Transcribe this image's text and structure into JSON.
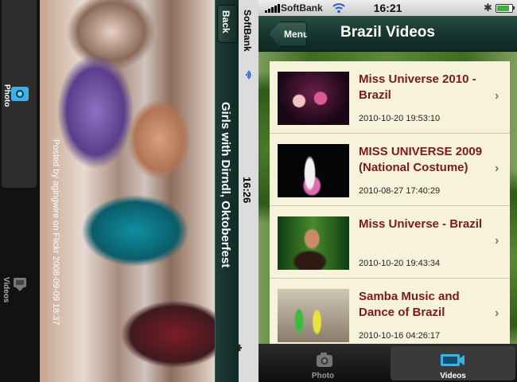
{
  "photo_screen": {
    "title": "Girls with Dirndl, Oktoberfest",
    "back_label": "Back",
    "caption": "Posted by agingwire on Flickr 2008-09-09 18:37",
    "status": {
      "carrier": "SoftBank",
      "time": "16:26"
    },
    "tabs": [
      {
        "label": "Photo",
        "icon": "camera-icon",
        "selected": true
      },
      {
        "label": "Videos",
        "icon": "video-camera-icon",
        "selected": false
      }
    ]
  },
  "video_screen": {
    "status": {
      "carrier": "SoftBank",
      "time": "16:21",
      "battery_level": 0.85
    },
    "navbar": {
      "title": "Brazil Videos",
      "menu_label": "Menu"
    },
    "videos": [
      {
        "title": "Miss Universe 2010 - Brazil",
        "date": "2010-10-20 19:53:10"
      },
      {
        "title": "MISS UNIVERSE 2009 (National Costume)",
        "date": "2010-08-27 17:40:29"
      },
      {
        "title": "Miss Universe - Brazil",
        "date": "2010-10-20 19:43:34"
      },
      {
        "title": "Samba Music and Dance of Brazil",
        "date": "2010-10-16 04:26:17"
      }
    ],
    "tabs": [
      {
        "label": "Photo",
        "icon": "camera-icon",
        "selected": false
      },
      {
        "label": "Videos",
        "icon": "video-camera-icon",
        "selected": true
      }
    ],
    "colors": {
      "accent": "#17352e",
      "title_text": "#7a1a1a",
      "list_background": "#f7f3da"
    }
  }
}
